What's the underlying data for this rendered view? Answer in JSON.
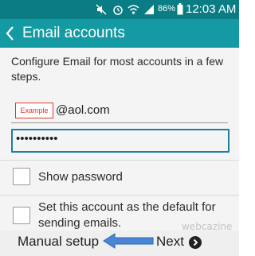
{
  "status_bar": {
    "battery_percent": "86%",
    "time": "12:03 AM",
    "icons": [
      "mute-icon",
      "alarm-icon",
      "wifi-icon",
      "signal-icon",
      "battery-icon"
    ]
  },
  "action_bar": {
    "title": "Email accounts",
    "back_icon": "chevron-left-icon"
  },
  "form": {
    "intro": "Configure Email for most accounts in a few steps.",
    "email_example_tag": "Example",
    "email_domain": "@aol.com",
    "password_value": "••••••••••",
    "show_password_label": "Show password",
    "show_password_checked": false,
    "default_account_label": "Set this account as the default for sending emails.",
    "default_account_checked": false
  },
  "bottom_bar": {
    "manual_setup_label": "Manual setup",
    "next_label": "Next",
    "next_icon": "chevron-right-circle-icon"
  },
  "watermark": "webcazine",
  "colors": {
    "status_bar": "#0a7c84",
    "action_bar": "#139aa3",
    "focus_border": "#1a7fa0",
    "example_tag": "#e0362a",
    "annotation_arrow": "#4a86d6"
  }
}
